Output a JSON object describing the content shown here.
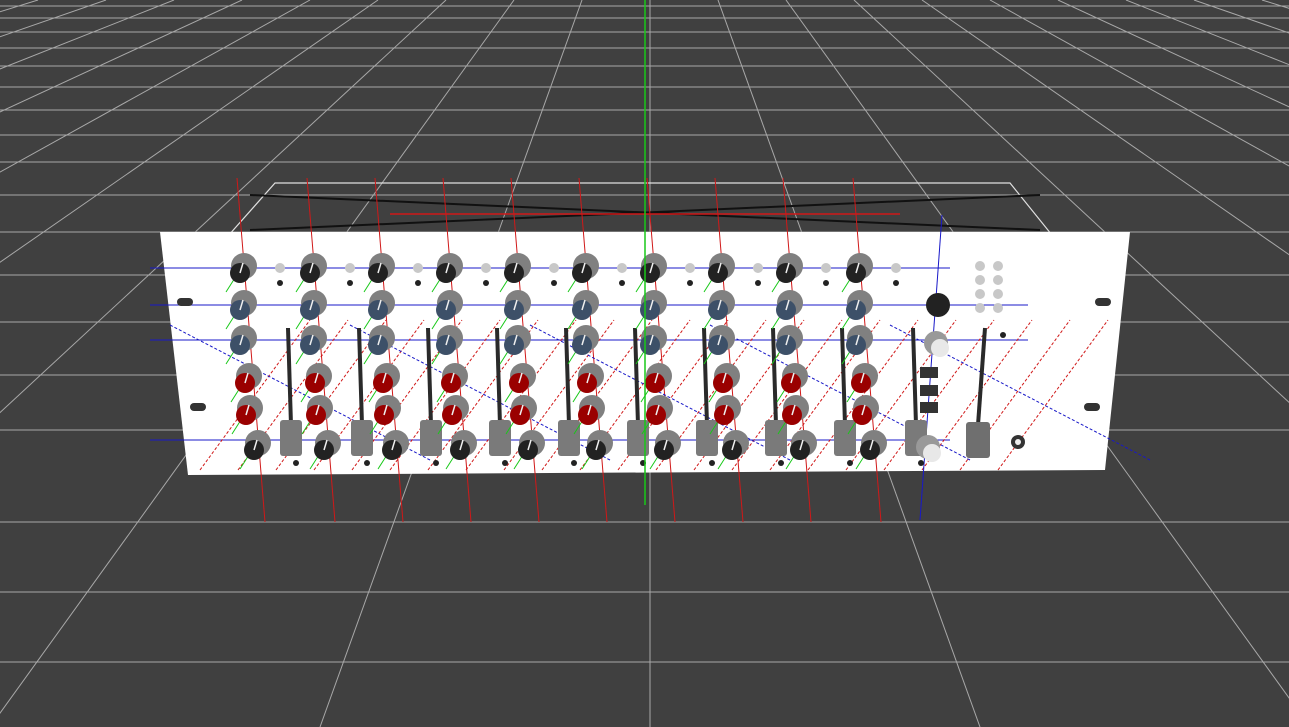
{
  "scene": {
    "background": "#404040",
    "grid_color": "#a8a8a8",
    "axis_colors": {
      "x": "#d01818",
      "y": "#18c818",
      "z": "#1818c8"
    },
    "panel_color": "#ffffff",
    "channel_count": 10,
    "knob_rows": [
      {
        "cap": "#222222"
      },
      {
        "cap": "#3d5068"
      },
      {
        "cap": "#3d5068"
      },
      {
        "cap": "#9a0000"
      },
      {
        "cap": "#9a0000"
      },
      {
        "cap": "#222222"
      }
    ],
    "knob_body": "#808080",
    "fader_cap": "#7a7a7a"
  }
}
